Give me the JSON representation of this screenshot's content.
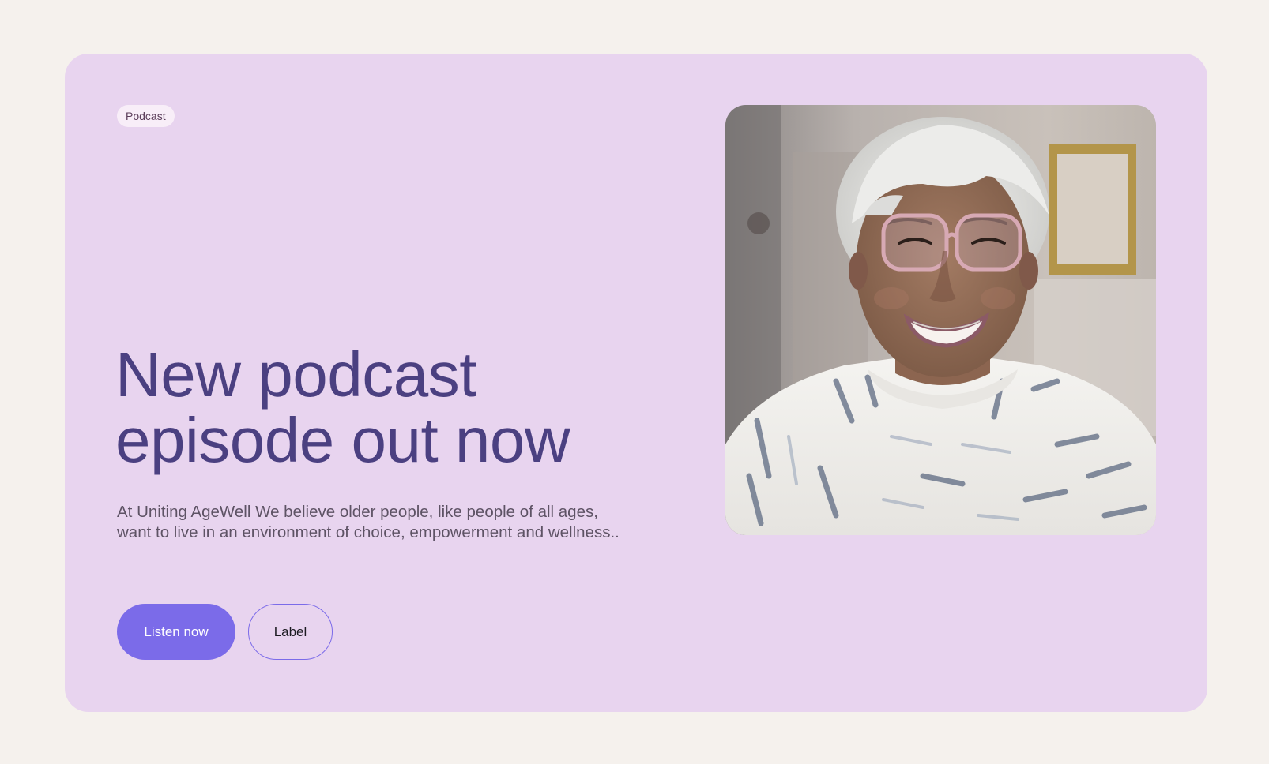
{
  "card": {
    "badge_label": "Podcast",
    "headline_line1": "New podcast",
    "headline_line2": "episode out now",
    "description": "At Uniting AgeWell We believe older people, like people of all ages, want to live in an environment of choice, empowerment and wellness..",
    "primary_button_label": "Listen now",
    "secondary_button_label": "Label"
  },
  "colors": {
    "page_background": "#f5f1ed",
    "card_background": "#e8d4ef",
    "headline": "#4b4081",
    "accent": "#7b6be9"
  },
  "image": {
    "subject": "smiling-elderly-woman-photo"
  }
}
